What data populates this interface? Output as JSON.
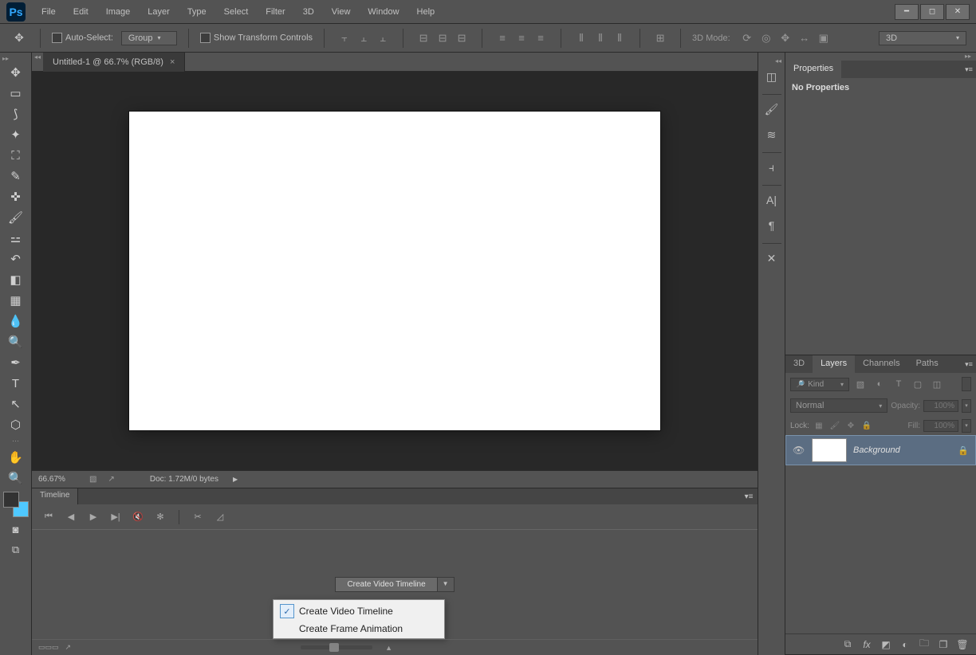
{
  "menubar": [
    "File",
    "Edit",
    "Image",
    "Layer",
    "Type",
    "Select",
    "Filter",
    "3D",
    "View",
    "Window",
    "Help"
  ],
  "optionsbar": {
    "auto_select": "Auto-Select:",
    "group": "Group",
    "show_transform": "Show Transform Controls",
    "mode3d_label": "3D Mode:",
    "select_3d": "3D"
  },
  "doc_tab": {
    "title": "Untitled-1 @ 66.7% (RGB/8)"
  },
  "statusbar": {
    "zoom": "66.67%",
    "doc": "Doc: 1.72M/0 bytes"
  },
  "timeline": {
    "tab": "Timeline",
    "create_btn": "Create Video Timeline",
    "dd_video": "Create Video Timeline",
    "dd_frame": "Create Frame Animation"
  },
  "properties_panel": {
    "tab": "Properties",
    "no_props": "No Properties"
  },
  "layers_panel": {
    "tabs": [
      "3D",
      "Layers",
      "Channels",
      "Paths"
    ],
    "filter_kind": "Kind",
    "blend_mode": "Normal",
    "opacity_label": "Opacity:",
    "opacity_val": "100%",
    "lock_label": "Lock:",
    "fill_label": "Fill:",
    "fill_val": "100%",
    "layer_name": "Background"
  }
}
